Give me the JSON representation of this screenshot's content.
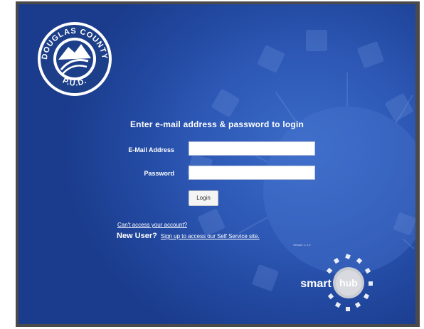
{
  "login": {
    "heading": "Enter e-mail address & password to login",
    "email_label": "E-Mail Address",
    "email_value": "",
    "password_label": "Password",
    "password_value": "",
    "login_button": "Login"
  },
  "links": {
    "cant_access": "Can't access your account?",
    "new_user_label": "New User?",
    "signup_link": "Sign up to access our Self Service site."
  },
  "version": "Version: 1.1.9",
  "logo": {
    "org_name_top": "DOUGLAS COUNTY",
    "org_name_bottom": "P.U.D.",
    "icon": "douglas-county-pud-logo"
  },
  "brand": {
    "smart": "smart",
    "hub": "hub",
    "icon": "smarthub-logo"
  },
  "colors": {
    "background_blue": "#2d58b5",
    "text": "#ffffff"
  }
}
